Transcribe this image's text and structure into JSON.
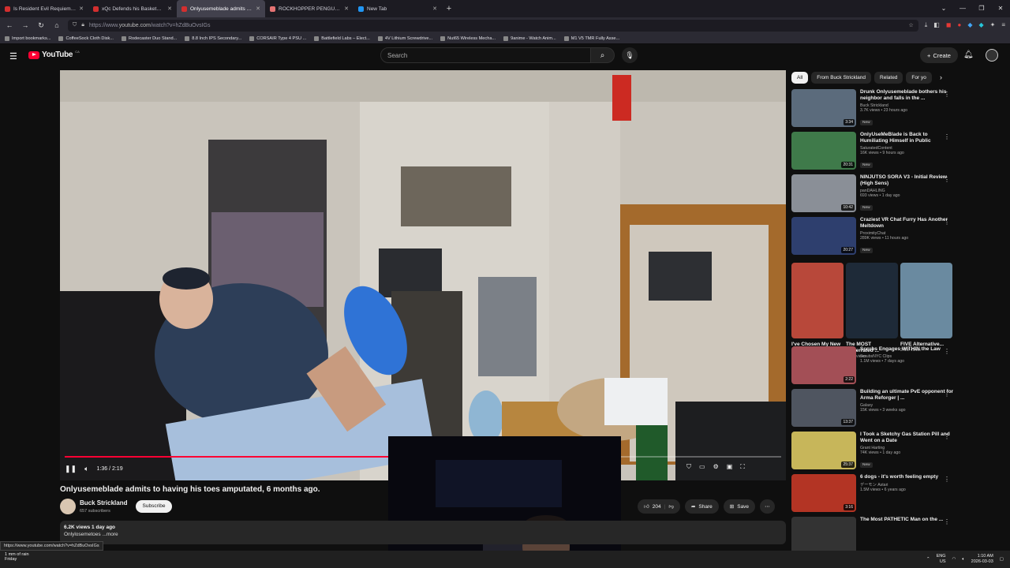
{
  "browser": {
    "tabs": [
      {
        "title": "Is Resident Evil Requiem Good",
        "color": "#d32f2f",
        "active": false
      },
      {
        "title": "xQc Defends his Basketball Skil",
        "color": "#d32f2f",
        "active": false
      },
      {
        "title": "Onlyusemeblade admits to havi",
        "subtitle": "PLAYING",
        "color": "#d32f2f",
        "active": true
      },
      {
        "title": "ROCKHOPPER PENGUIN at Dur",
        "color": "#e57373",
        "active": false
      },
      {
        "title": "New Tab",
        "color": "#2196f3",
        "active": false
      }
    ],
    "url_prefix": "https://www.",
    "url_host": "youtube.com",
    "url_path": "/watch?v=hZdBuOvsIGs",
    "bookmarks": [
      "Import bookmarks...",
      "CoffeeSock Cloth Disk...",
      "Rodecaster Duo Stand...",
      "8.8 Inch IPS Secondary...",
      "CORSAIR Type 4 PSU ...",
      "Battlefield Labs – Elect...",
      "4V Lithium Screwdrive...",
      "Nut65 Wireless Mecha...",
      "9anime - Watch Anim...",
      "M1 V5 TMR Fully Asse..."
    ]
  },
  "youtube": {
    "logo_text": "YouTube",
    "country": "CA",
    "search_placeholder": "Search",
    "create_label": "Create"
  },
  "player": {
    "time": "1:36 / 2:19",
    "progress_fraction": 0.69,
    "title": "Onlyusemeblade admits to having his toes amputated, 6 months ago.",
    "channel": "Buck Strickland",
    "subscribers": "657 subscribers",
    "subscribe_label": "Subscribe",
    "likes": "204",
    "share_label": "Share",
    "save_label": "Save",
    "desc_meta": "6.2K views  1 day ago",
    "desc_text": "Onlylosemetoes ...more",
    "status_url": "https://www.youtube.com/watch?v=hZdBuOvsIGs"
  },
  "sidebar": {
    "chips": [
      "All",
      "From Buck Strickland",
      "Related",
      "For yo"
    ],
    "recs_top": [
      {
        "title": "Drunk Onlyusemeblade bothers his neighbor and falls in the ...",
        "channel": "Buck Strickland",
        "meta": "3.7K views • 23 hours ago",
        "badge": "New",
        "duration": "3:34",
        "color": "#5b6b7c"
      },
      {
        "title": "OnlyUseMeBlade is Back to Humiliating Himself in Public",
        "channel": "SaturatedContent",
        "meta": "16K views • 9 hours ago",
        "badge": "New",
        "duration": "20:31",
        "color": "#3f7a4a"
      },
      {
        "title": "NINJUTSO SORA V3 - Initial Review (High Sens)",
        "channel": "panDAHLING",
        "meta": "693 views • 1 day ago",
        "badge": "New",
        "duration": "10:42",
        "color": "#8a8f97"
      },
      {
        "title": "Craziest VR Chat Furry Has Another Meltdown",
        "channel": "ProximityChat",
        "meta": "289K views • 11 hours ago",
        "badge": "New",
        "duration": "20:27",
        "color": "#2e3f6e"
      }
    ],
    "shorts": [
      {
        "title": "I've Chosen My New ...",
        "views": "2M views",
        "color": "#b8483a"
      },
      {
        "title": "The MOST Underrated ...",
        "views": "1.7M views",
        "color": "#1e2a38"
      },
      {
        "title": "FIVE Alternative...",
        "views": "2.6M views",
        "color": "#6a8aa0"
      }
    ],
    "recs_bottom": [
      {
        "title": "Scrubs Engages WITHIN the Law",
        "channel": "ScrubsNYC Clips",
        "meta": "1.1M views • 7 days ago",
        "badge": "",
        "duration": "2:22",
        "color": "#a34f56"
      },
      {
        "title": "Building an ultimate PvE opponent for Arma Reforger | ...",
        "channel": "Galaxy",
        "meta": "15K views • 3 weeks ago",
        "badge": "",
        "duration": "13:37",
        "color": "#4f5560"
      },
      {
        "title": "I Took a Sketchy Gas Station Pill and Went on a Date",
        "channel": "Grant Harting",
        "meta": "74K views • 1 day ago",
        "badge": "New",
        "duration": "25:37",
        "color": "#c7b65a"
      },
      {
        "title": "6 dogs - it's worth feeling empty",
        "channel": "デーモン Astari",
        "meta": "1.5M views • 6 years ago",
        "badge": "",
        "duration": "3:16",
        "color": "#b33424"
      },
      {
        "title": "The Most PATHETIC Man on the ...",
        "channel": "",
        "meta": "",
        "badge": "",
        "duration": "",
        "color": "#333333"
      }
    ]
  },
  "taskbar": {
    "weather": "1 mm of rain",
    "weather_day": "Friday",
    "lang": "ENG",
    "region": "US",
    "time": "1:10 AM",
    "date": "2026-03-03"
  }
}
